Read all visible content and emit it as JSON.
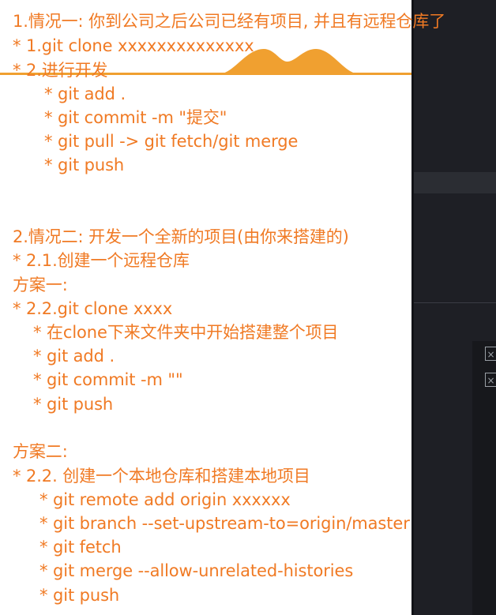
{
  "colors": {
    "text": "#f07a24",
    "accent_decoration": "#f0a030",
    "editor_background": "#1e1f25"
  },
  "notes": {
    "case1_title": "1.情况一: 你到公司之后公司已经有项目, 并且有远程仓库了",
    "case1_step1": "* 1.git clone xxxxxxxxxxxxxx",
    "case1_step2": "* 2.进行开发",
    "case1_cmd_add": "* git add .",
    "case1_cmd_commit": "* git commit -m \"提交\"",
    "case1_cmd_pull": "* git pull -> git fetch/git merge",
    "case1_cmd_push": "* git push",
    "case2_title": "2.情况二: 开发一个全新的项目(由你来搭建的)",
    "case2_step1": "* 2.1.创建一个远程仓库",
    "plan1_title": "方案一:",
    "plan1_step": "* 2.2.git clone xxxx",
    "plan1_cmd_build": "* 在clone下来文件夹中开始搭建整个项目",
    "plan1_cmd_add": "* git add .",
    "plan1_cmd_commit": "* git commit -m \"\"",
    "plan1_cmd_push": "* git push",
    "plan2_title": "方案二:",
    "plan2_step": "* 2.2. 创建一个本地仓库和搭建本地项目",
    "plan2_cmd_remote": "* git remote add origin xxxxxx",
    "plan2_cmd_branch": "* git branch --set-upstream-to=origin/master",
    "plan2_cmd_fetch": "* git fetch",
    "plan2_cmd_merge": "* git merge --allow-unrelated-histories",
    "plan2_cmd_push": "* git push"
  },
  "editor": {
    "close_icon_1": "×",
    "close_icon_2": "×",
    "icon_name": "close-icon"
  }
}
